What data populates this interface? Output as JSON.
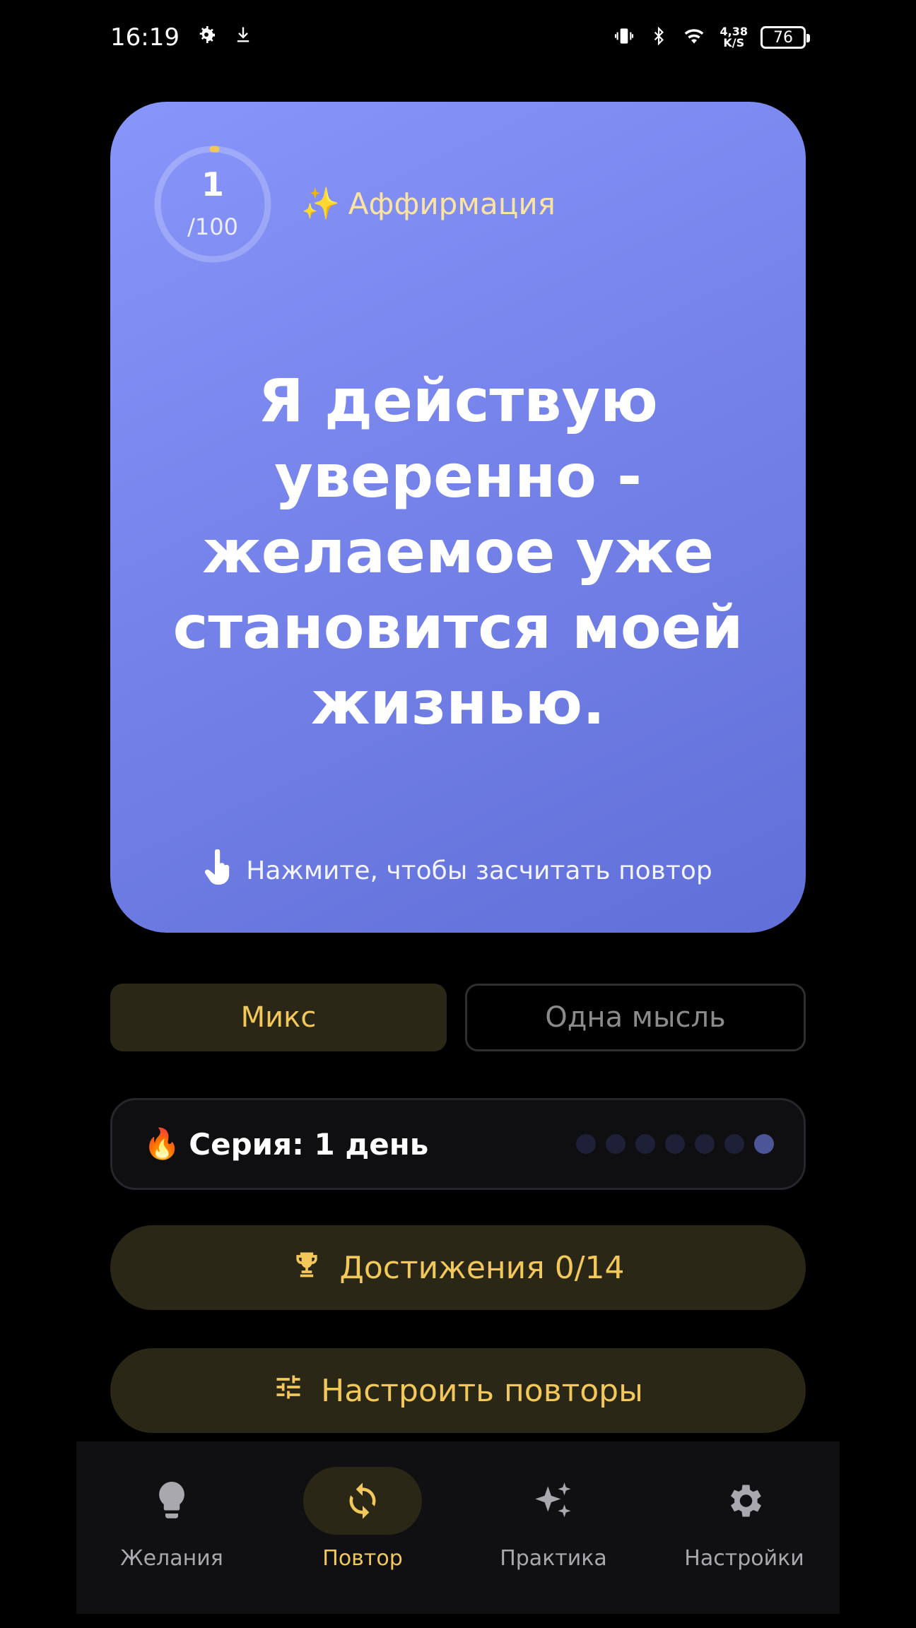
{
  "status_bar": {
    "time": "16:19",
    "net_speed_value": "4,38",
    "net_speed_unit": "K/S",
    "battery": "76"
  },
  "card": {
    "counter_current": "1",
    "counter_total": "/100",
    "counter_progress": 0.01,
    "tag": "Аффирмация",
    "text": "Я действую уверенно - желаемое уже становится моей жизнью.",
    "tap_hint": "Нажмите, чтобы засчитать повтор",
    "gradient_start": "#8896fb",
    "gradient_end": "#6070d8"
  },
  "modes": {
    "mix_label": "Микс",
    "single_label": "Одна мысль",
    "selected": "mix"
  },
  "streak": {
    "label": "Серия: 1 день",
    "days_total": 7,
    "days_done": 1
  },
  "achievements_label": "Достижения 0/14",
  "configure_label": "Настроить повторы",
  "nav": {
    "items": [
      {
        "label": "Желания",
        "icon": "lightbulb-icon"
      },
      {
        "label": "Повтор",
        "icon": "repeat-icon"
      },
      {
        "label": "Практика",
        "icon": "sparkles-icon"
      },
      {
        "label": "Настройки",
        "icon": "gear-icon"
      }
    ],
    "active": 1
  },
  "colors": {
    "accent": "#f2c85b",
    "accent_bg": "#2b2716",
    "background": "#000000"
  }
}
